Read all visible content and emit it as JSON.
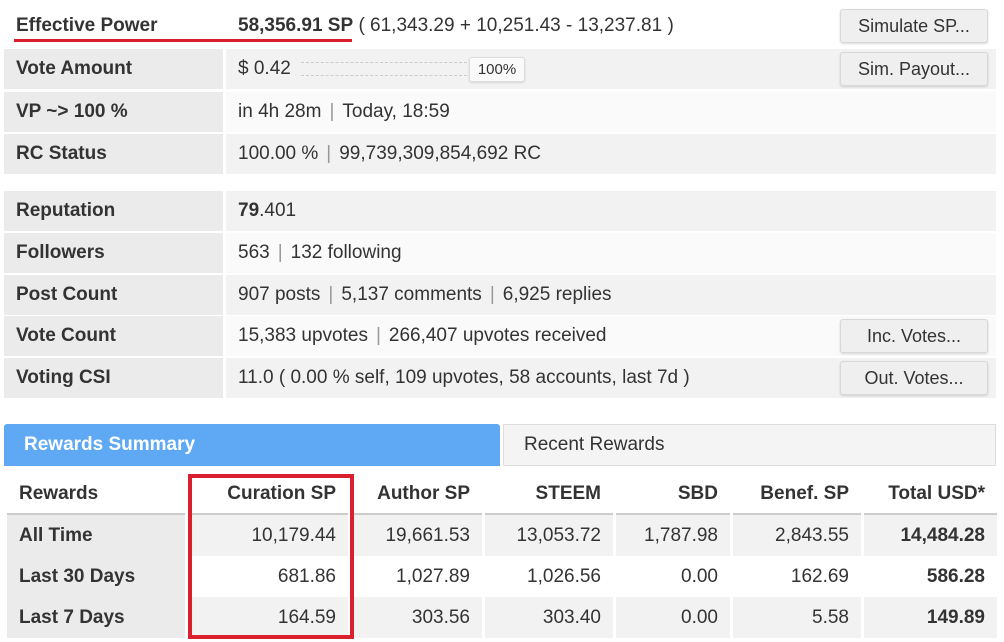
{
  "stats": {
    "effective_power": {
      "label": "Effective Power",
      "value": "58,356.91 SP",
      "breakdown": "( 61,343.29 + 10,251.43 - 13,237.81 )",
      "button": "Simulate SP..."
    },
    "vote_amount": {
      "label": "Vote Amount",
      "value": "$ 0.42",
      "percent": "100%",
      "fill": 1.0,
      "button": "Sim. Payout..."
    },
    "vp": {
      "label": "VP ~> 100 %",
      "time": "in 4h 28m",
      "when": "Today, 18:59"
    },
    "rc": {
      "label": "RC Status",
      "percent": "100.00 %",
      "amount": "99,739,309,854,692 RC"
    },
    "reputation": {
      "label": "Reputation",
      "int": "79",
      "dec": ".401"
    },
    "followers": {
      "label": "Followers",
      "count": "563",
      "following": "132 following"
    },
    "post_count": {
      "label": "Post Count",
      "posts": "907 posts",
      "comments": "5,137 comments",
      "replies": "6,925 replies"
    },
    "vote_count": {
      "label": "Vote Count",
      "upvotes": "15,383 upvotes",
      "received": "266,407 upvotes received",
      "button": "Inc. Votes..."
    },
    "voting_csi": {
      "label": "Voting CSI",
      "value": "11.0 ( 0.00 % self, 109 upvotes, 58 accounts, last 7d )",
      "button": "Out. Votes..."
    }
  },
  "tabs": {
    "active": "Rewards Summary",
    "other": "Recent Rewards"
  },
  "rewards": {
    "headers": [
      "Rewards",
      "Curation SP",
      "Author SP",
      "STEEM",
      "SBD",
      "Benef. SP",
      "Total USD*"
    ],
    "rows": [
      [
        "All Time",
        "10,179.44",
        "19,661.53",
        "13,053.72",
        "1,787.98",
        "2,843.55",
        "14,484.28"
      ],
      [
        "Last 30 Days",
        "681.86",
        "1,027.89",
        "1,026.56",
        "0.00",
        "162.69",
        "586.28"
      ],
      [
        "Last 7 Days",
        "164.59",
        "303.56",
        "303.40",
        "0.00",
        "5.58",
        "149.89"
      ]
    ]
  },
  "colors": {
    "accent": "#5fa9f4",
    "highlight": "#d9202c"
  }
}
